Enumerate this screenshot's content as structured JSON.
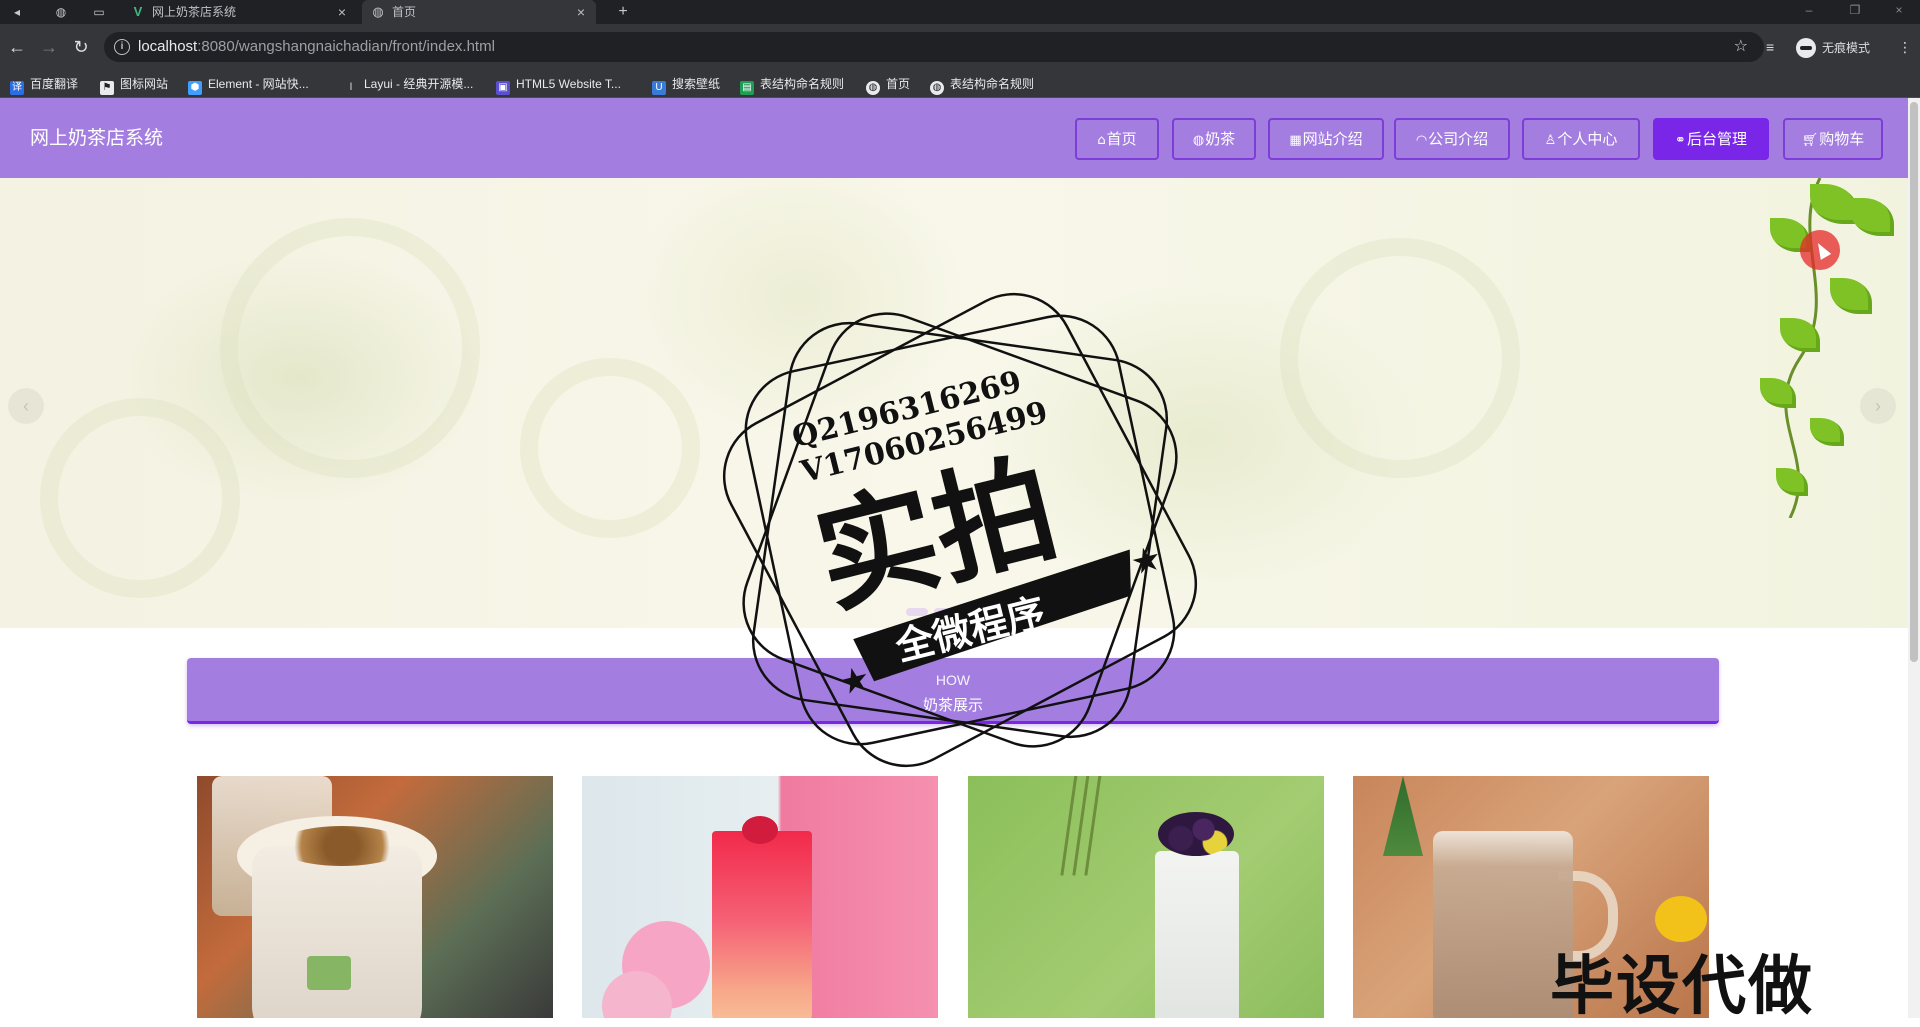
{
  "browser": {
    "tabs": [
      {
        "title": "网上奶茶店系统",
        "icon": "vue-icon"
      },
      {
        "title": "首页",
        "icon": "globe-icon"
      }
    ],
    "new_tab_symbol": "+",
    "url_host": "localhost",
    "url_rest": ":8080/wangshangnaichadian/front/index.html",
    "incognito_label": "无痕模式",
    "bookmarks": [
      {
        "label": "百度翻译",
        "icon": "translate-icon",
        "color": "#2b6de5"
      },
      {
        "label": "图标网站",
        "icon": "flag-icon",
        "color": "#202124"
      },
      {
        "label": "Element - 网站快...",
        "icon": "element-icon",
        "color": "#409eff"
      },
      {
        "label": "Layui - 经典开源模...",
        "icon": "layui-icon",
        "color": "#555555"
      },
      {
        "label": "HTML5 Website T...",
        "icon": "html5-icon",
        "color": "#5a4fcf"
      },
      {
        "label": "搜索壁纸",
        "icon": "wallpaper-icon",
        "color": "#3b7bd8"
      },
      {
        "label": "表结构命名规则",
        "icon": "sheet-icon",
        "color": "#1f9d55"
      },
      {
        "label": "首页",
        "icon": "globe-icon",
        "color": "#202124"
      },
      {
        "label": "表结构命名规则",
        "icon": "globe-icon",
        "color": "#202124"
      }
    ]
  },
  "site": {
    "title": "网上奶茶店系统",
    "nav": [
      {
        "label": "首页",
        "icon": "home-icon",
        "active": false
      },
      {
        "label": "奶茶",
        "icon": "cup-icon",
        "active": false
      },
      {
        "label": "网站介绍",
        "icon": "info-icon",
        "active": false
      },
      {
        "label": "公司介绍",
        "icon": "company-icon",
        "active": false
      },
      {
        "label": "个人中心",
        "icon": "user-icon",
        "active": false
      },
      {
        "label": "后台管理",
        "icon": "link-icon",
        "active": true
      },
      {
        "label": "购物车",
        "icon": "cart-icon",
        "active": false
      }
    ],
    "colors": {
      "primary": "#a37ee0",
      "accent": "#7a26e8"
    },
    "carousel": {
      "dots": 3,
      "active_dot": 3,
      "prev_arrow": "‹",
      "next_arrow": "›"
    },
    "section": {
      "title_en": "HOW",
      "title_cn": "奶茶展示"
    },
    "products": [
      "card-1",
      "card-2",
      "card-3",
      "card-4"
    ]
  },
  "watermark": {
    "qq": "Q2196316269",
    "wechat": "V17060256499",
    "main": "实拍",
    "ribbon": "全微程序",
    "corner": "毕设代做"
  }
}
